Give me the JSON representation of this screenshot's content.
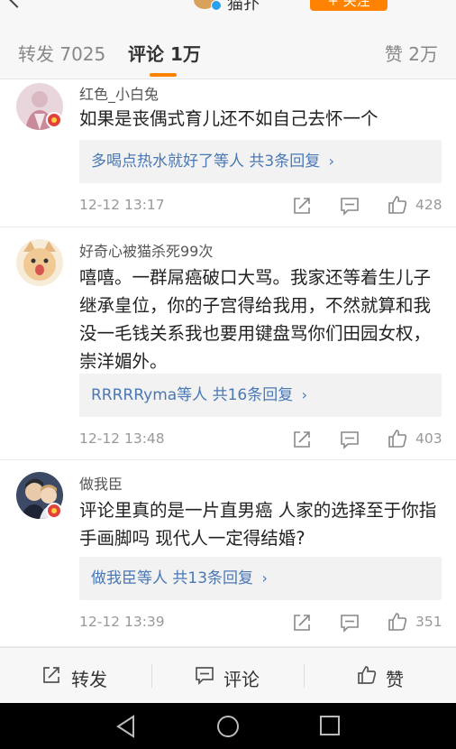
{
  "header": {
    "name": "猫扑",
    "follow_label": "+ 关注"
  },
  "tabs": {
    "repost": "转发 7025",
    "comment": "评论 1万",
    "like": "赞 2万"
  },
  "comments": [
    {
      "username": "红色_小白兔",
      "text": "如果是丧偶式育儿还不如自己去怀一个",
      "reply_users": "多喝点热水就好了等人",
      "reply_count": "共3条回复",
      "time": "12-12 13:17",
      "likes": "428"
    },
    {
      "username": "好奇心被猫杀死99次",
      "text": "嘻嘻。一群屌癌破口大骂。我家还等着生儿子继承皇位，你的子宫得给我用，不然就算和我没一毛钱关系我也要用键盘骂你们田园女权，崇洋媚外。",
      "reply_users": "RRRRRyma等人",
      "reply_count": "共16条回复",
      "time": "12-12 13:48",
      "likes": "403"
    },
    {
      "username": "做我臣",
      "text": "评论里真的是一片直男癌 人家的选择至于你指手画脚吗 现代人一定得结婚?",
      "reply_users": "做我臣等人",
      "reply_count": "共13条回复",
      "time": "12-12 13:39",
      "likes": "351"
    }
  ],
  "chevron": "›",
  "bottom_bar": {
    "repost": "转发",
    "comment": "评论",
    "like": "赞"
  },
  "colors": {
    "accent": "#ff8200",
    "link": "#4a78b5",
    "badge": "#e2423c"
  }
}
